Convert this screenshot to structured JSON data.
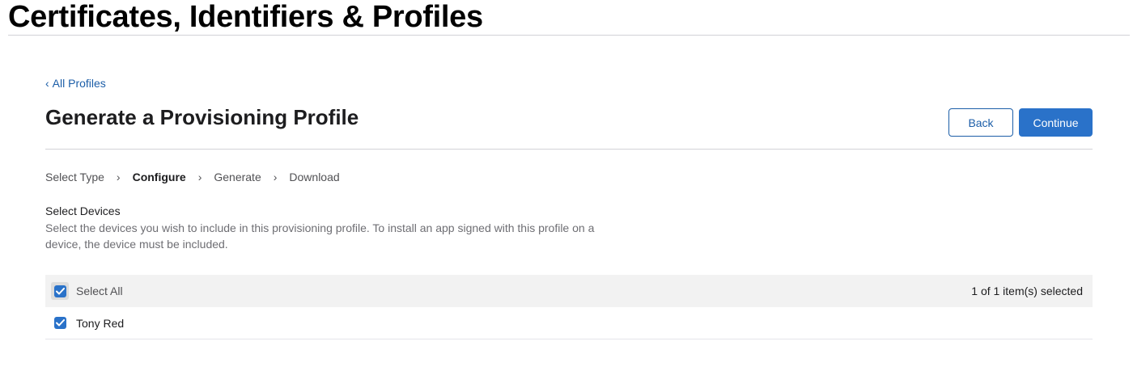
{
  "site": {
    "title": "Certificates, Identifiers & Profiles"
  },
  "nav": {
    "back_link": "All Profiles",
    "back_chevron": "‹"
  },
  "header": {
    "title": "Generate a Provisioning Profile",
    "back_button": "Back",
    "continue_button": "Continue"
  },
  "steps": [
    {
      "label": "Select Type",
      "current": false
    },
    {
      "label": "Configure",
      "current": true
    },
    {
      "label": "Generate",
      "current": false
    },
    {
      "label": "Download",
      "current": false
    }
  ],
  "step_separator": "›",
  "devices": {
    "title": "Select Devices",
    "description": "Select the devices you wish to include in this provisioning profile. To install an app signed with this profile on a device, the device must be included.",
    "select_all_label": "Select All",
    "select_all_checked": true,
    "selection_count": "1 of 1 item(s) selected",
    "items": [
      {
        "name": "Tony Red",
        "checked": true
      }
    ]
  },
  "colors": {
    "accent": "#2a72c9",
    "link": "#1c5ea8",
    "header_row_bg": "#f2f2f2"
  }
}
